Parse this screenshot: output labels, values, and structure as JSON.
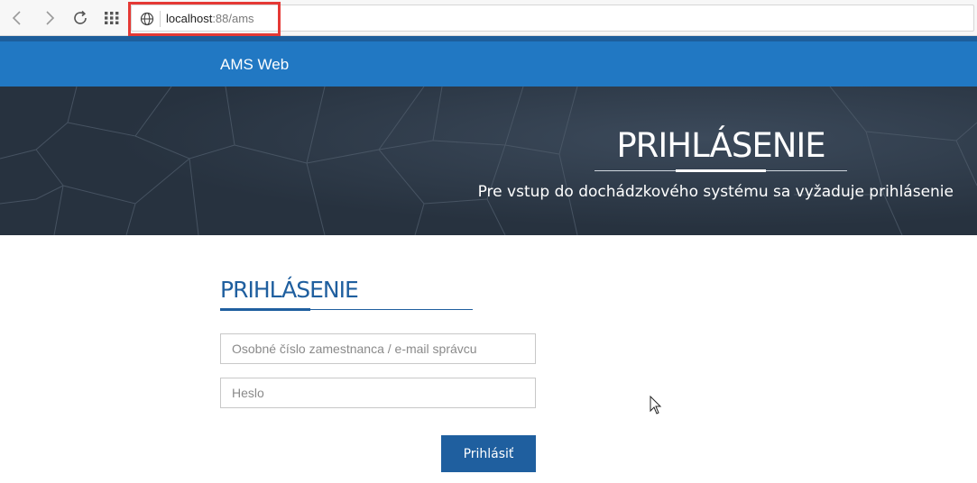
{
  "browser": {
    "url_host": "localhost",
    "url_rest": ":88/ams",
    "icons": [
      "back-icon",
      "forward-icon",
      "reload-icon",
      "apps-grid-icon",
      "globe-icon"
    ]
  },
  "navbar": {
    "brand": "AMS Web"
  },
  "hero": {
    "title": "PRIHLÁSENIE",
    "subtitle": "Pre vstup do dochádzkového systému sa vyžaduje prihlásenie"
  },
  "login": {
    "title": "PRIHLÁSENIE",
    "user_placeholder": "Osobné číslo zamestnanca / e-mail správcu",
    "password_placeholder": "Heslo",
    "submit_label": "Prihlásiť"
  },
  "colors": {
    "navbar": "#2178c3",
    "hero_bg": "#2a3645",
    "accent": "#1f5f9f",
    "url_highlight": "#e53935"
  }
}
